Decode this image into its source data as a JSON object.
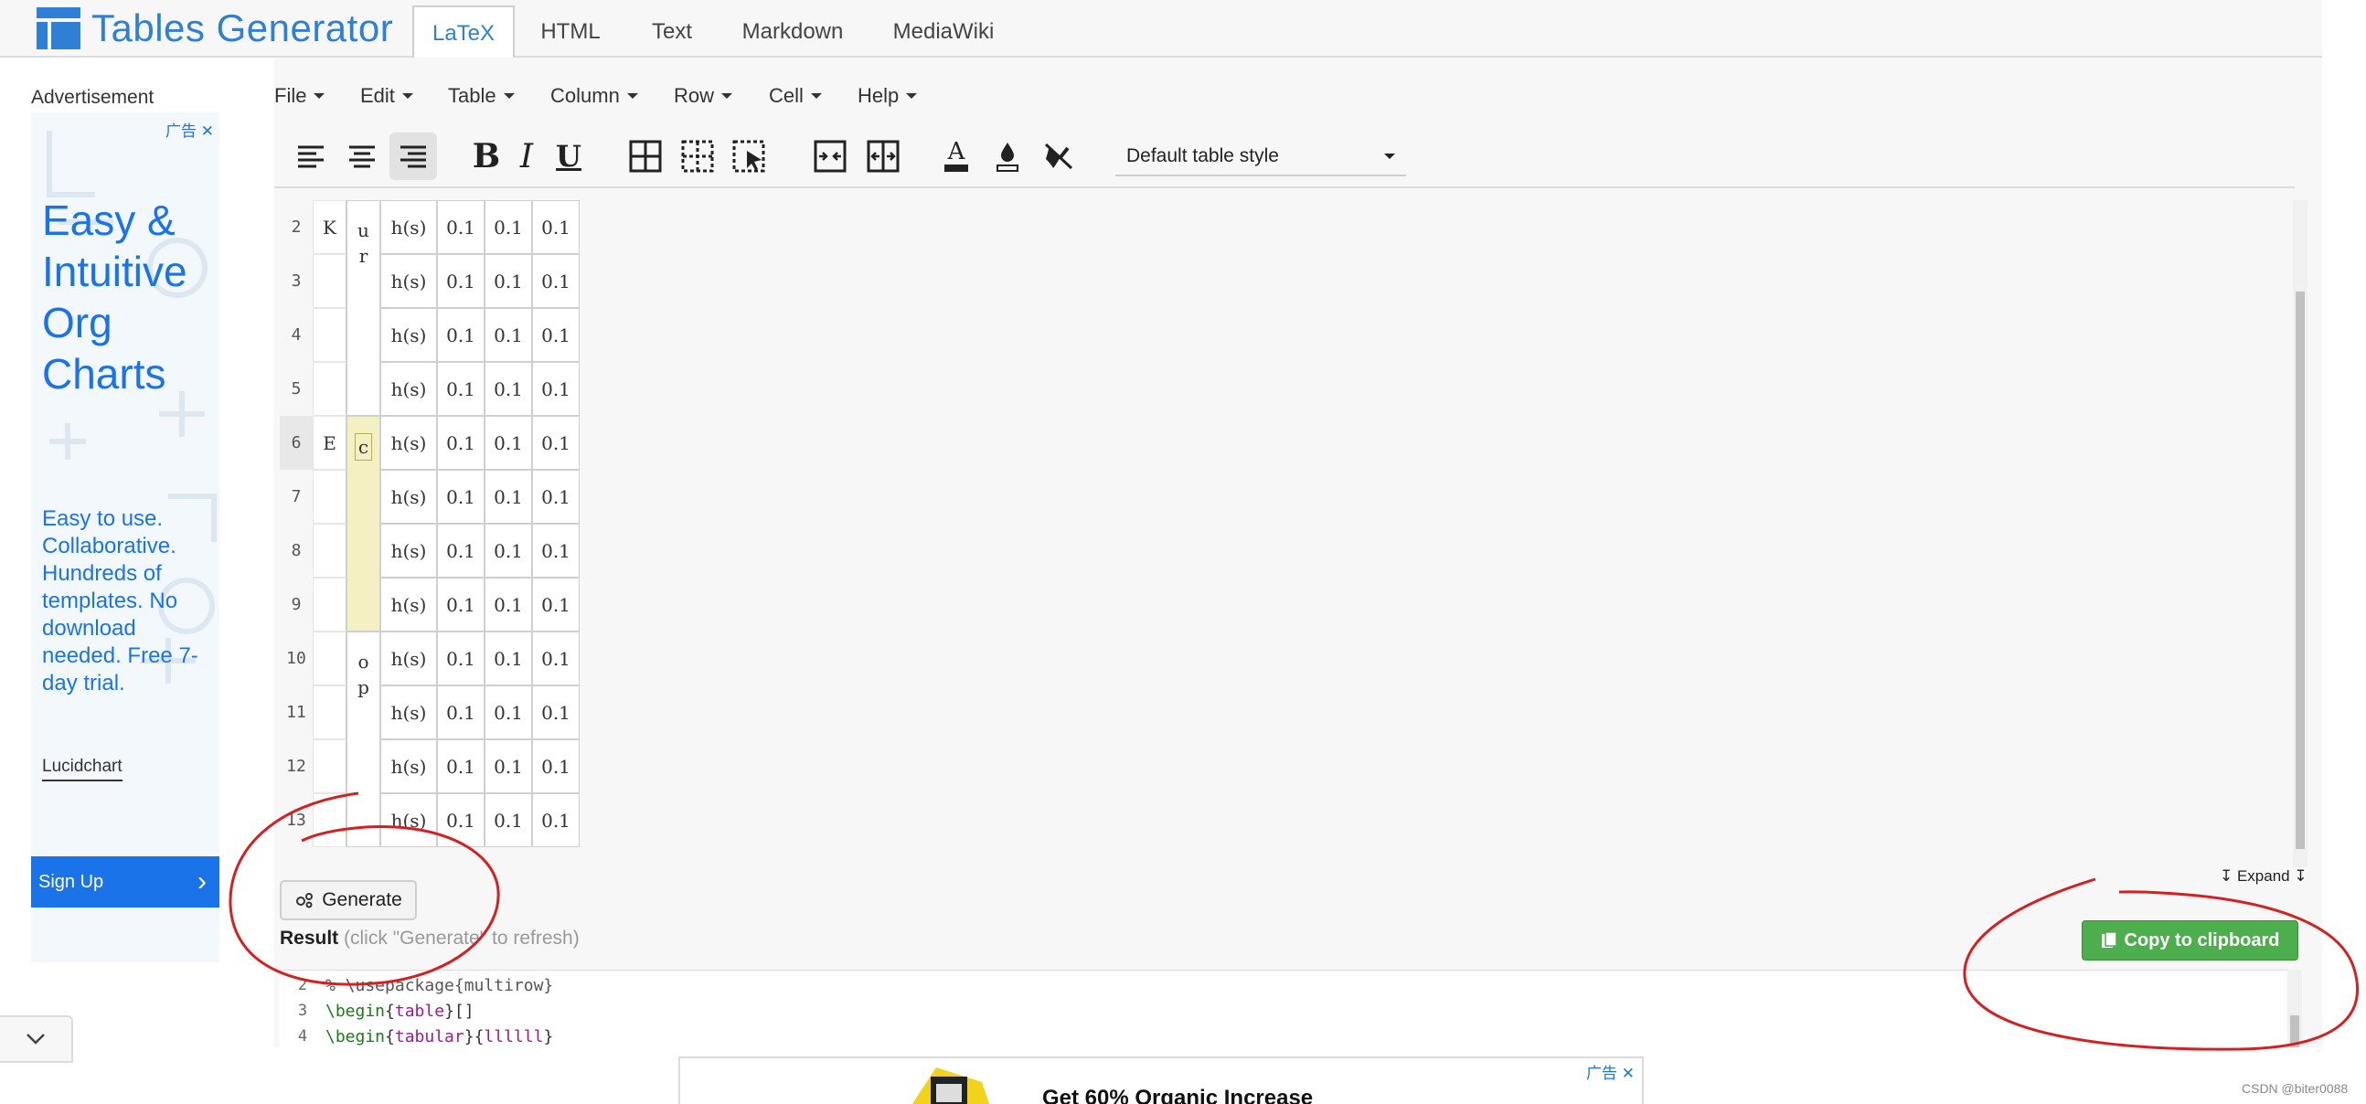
{
  "app": {
    "logo_text": "Tables Generator",
    "tabs": [
      "LaTeX",
      "HTML",
      "Text",
      "Markdown",
      "MediaWiki"
    ],
    "active_tab": "LaTeX"
  },
  "sidebar": {
    "ad_label": "Advertisement",
    "ad_close": "广告 ✕",
    "ad_headline": "Easy & Intuitive Org Charts",
    "ad_body": "Easy to use. Collaborative. Hundreds of templates. No download needed. Free 7-day trial.",
    "ad_brand": "Lucidchart",
    "signup_label": "Sign Up",
    "signup_arrow": "›"
  },
  "menu": [
    "File",
    "Edit",
    "Table",
    "Column",
    "Row",
    "Cell",
    "Help"
  ],
  "toolbar": {
    "icons": [
      "align-left-icon",
      "align-center-icon",
      "align-right-icon",
      "bold-icon",
      "italic-icon",
      "underline-icon",
      "all-borders-icon",
      "dashed-borders-icon",
      "select-borders-icon",
      "merge-cells-icon",
      "split-cells-icon",
      "text-color-icon",
      "background-color-icon",
      "clear-format-icon"
    ],
    "bold": "B",
    "italic": "I",
    "underline": "U",
    "text_color": "A",
    "table_style": "Default table style"
  },
  "editor": {
    "row_numbers": [
      "2",
      "3",
      "4",
      "5",
      "6",
      "7",
      "8",
      "9",
      "10",
      "11",
      "12",
      "13"
    ],
    "active_row": "6",
    "rows": [
      [
        "K",
        "u\nr",
        "h(s)",
        "0.1",
        "0.1",
        "0.1"
      ],
      [
        "",
        "",
        "h(s)",
        "0.1",
        "0.1",
        "0.1"
      ],
      [
        "",
        "",
        "h(s)",
        "0.1",
        "0.1",
        "0.1"
      ],
      [
        "",
        "",
        "h(s)",
        "0.1",
        "0.1",
        "0.1"
      ],
      [
        "E",
        "c",
        "h(s)",
        "0.1",
        "0.1",
        "0.1"
      ],
      [
        "",
        "",
        "h(s)",
        "0.1",
        "0.1",
        "0.1"
      ],
      [
        "",
        "",
        "h(s)",
        "0.1",
        "0.1",
        "0.1"
      ],
      [
        "",
        "",
        "h(s)",
        "0.1",
        "0.1",
        "0.1"
      ],
      [
        "",
        "o\np",
        "h(s)",
        "0.1",
        "0.1",
        "0.1"
      ],
      [
        "",
        "",
        "h(s)",
        "0.1",
        "0.1",
        "0.1"
      ],
      [
        "",
        "",
        "h(s)",
        "0.1",
        "0.1",
        "0.1"
      ],
      [
        "",
        "",
        "h(s)",
        "0.1",
        "0.1",
        "0.1"
      ]
    ]
  },
  "expand_label": "↧ Expand ↧",
  "generate_label": "Generate",
  "result": {
    "label": "Result",
    "hint": " (click \"Generate\" to refresh)"
  },
  "copy_label": "Copy to clipboard",
  "code_lines": [
    {
      "ln": "2",
      "parts": [
        {
          "t": "% \\usepackage{multirow}",
          "c": "comment"
        }
      ]
    },
    {
      "ln": "3",
      "parts": [
        {
          "t": "\\begin",
          "c": "kw"
        },
        {
          "t": "{",
          "c": "plain"
        },
        {
          "t": "table",
          "c": "arg"
        },
        {
          "t": "}[]",
          "c": "plain"
        }
      ]
    },
    {
      "ln": "4",
      "parts": [
        {
          "t": "\\begin",
          "c": "kw"
        },
        {
          "t": "{",
          "c": "plain"
        },
        {
          "t": "tabular",
          "c": "arg"
        },
        {
          "t": "}{",
          "c": "plain"
        },
        {
          "t": "llllll",
          "c": "arg"
        },
        {
          "t": "}",
          "c": "plain"
        }
      ]
    }
  ],
  "bottom_ad": {
    "text": "Get 60% Organic Increase",
    "close": "广告 ✕"
  },
  "watermark": "CSDN @biter0088",
  "colors": {
    "brand_blue": "#2f7fd4",
    "ad_blue": "#1a73e8",
    "copy_green": "#4cae4c",
    "selected_cell": "#f5f0c4",
    "annotation_red": "#d42020"
  }
}
